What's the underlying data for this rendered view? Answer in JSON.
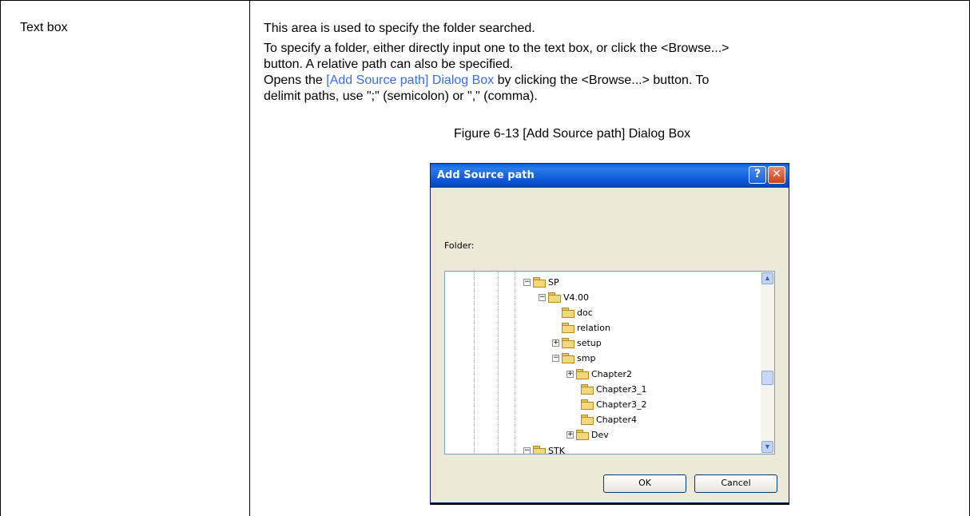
{
  "row": {
    "term": "Text box",
    "lines": {
      "l1": "This area is used to specify the folder searched.",
      "l2": "To specify a folder, either directly input one to the text box, or click the <Browse...>",
      "l3": "button. A relative path can also be specified.",
      "l4a": "Opens the ",
      "l4link": "[Add Source path] Dialog Box",
      "l4b": " by clicking the <Browse...> button.  To",
      "l5": "delimit paths, use \";\" (semicolon) or \",\" (comma)."
    }
  },
  "figure": {
    "caption": "Figure 6-13 [Add Source path] Dialog Box"
  },
  "dialog": {
    "title": "Add Source path",
    "help_glyph": "?",
    "close_glyph": "✕",
    "folder_label": "Folder:",
    "tree": [
      {
        "label": "SP",
        "toggle": "−"
      },
      {
        "label": "V4.00",
        "toggle": "−"
      },
      {
        "label": "doc",
        "toggle": ""
      },
      {
        "label": "relation",
        "toggle": ""
      },
      {
        "label": "setup",
        "toggle": "+"
      },
      {
        "label": "smp",
        "toggle": "−"
      },
      {
        "label": "Chapter2",
        "toggle": "+"
      },
      {
        "label": "Chapter3_1",
        "toggle": ""
      },
      {
        "label": "Chapter3_2",
        "toggle": ""
      },
      {
        "label": "Chapter4",
        "toggle": ""
      },
      {
        "label": "Dev",
        "toggle": "+"
      },
      {
        "label": "STK",
        "toggle": "−"
      }
    ],
    "ok_label": "OK",
    "cancel_label": "Cancel",
    "accent_color": "#0a5fd8"
  }
}
